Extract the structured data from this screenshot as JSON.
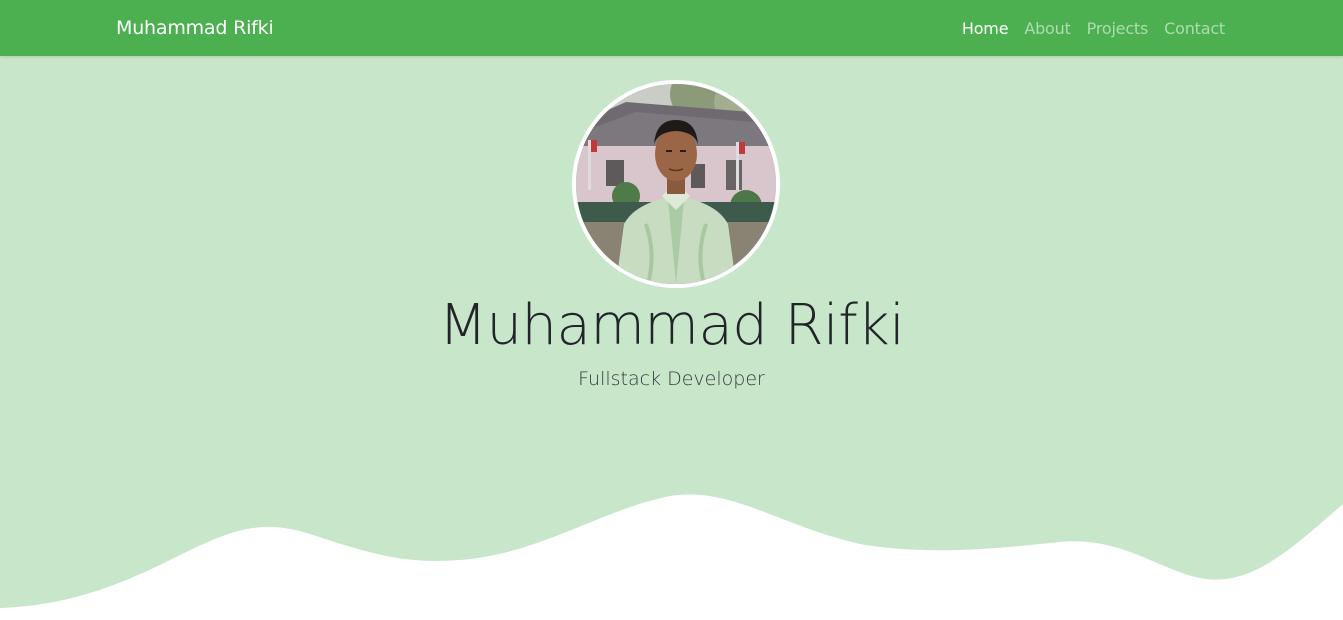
{
  "navbar": {
    "brand": "Muhammad Rifki",
    "links": [
      {
        "label": "Home",
        "active": true
      },
      {
        "label": "About",
        "active": false
      },
      {
        "label": "Projects",
        "active": false
      },
      {
        "label": "Contact",
        "active": false
      }
    ]
  },
  "hero": {
    "name": "Muhammad Rifki",
    "role": "Fullstack Developer",
    "avatar": "profile-photo"
  },
  "colors": {
    "navbar": "#4caf50",
    "hero_background": "#c8e6c9",
    "wave": "#ffffff"
  }
}
